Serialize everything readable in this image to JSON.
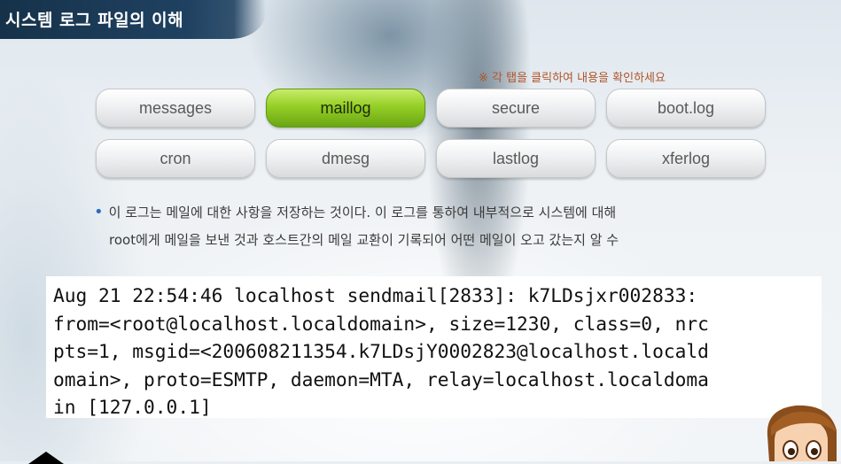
{
  "title": "시스템 로그 파일의 이해",
  "notice": "※ 각 탭을 클릭하여 내용을 확인하세요",
  "tabs": [
    {
      "label": "messages",
      "active": false
    },
    {
      "label": "maillog",
      "active": true
    },
    {
      "label": "secure",
      "active": false
    },
    {
      "label": "boot.log",
      "active": false
    },
    {
      "label": "cron",
      "active": false
    },
    {
      "label": "dmesg",
      "active": false
    },
    {
      "label": "lastlog",
      "active": false
    },
    {
      "label": "xferlog",
      "active": false
    }
  ],
  "description": {
    "line1": "이 로그는 메일에 대한 사항을 저장하는 것이다. 이 로그를 통하여 내부적으로 시스템에 대해",
    "line2": "root에게 메일을 보낸 것과 호스트간의 메일 교환이 기록되어 어떤 메일이 오고 갔는지 알 수"
  },
  "log_lines": [
    "Aug 21 22:54:46 localhost sendmail[2833]: k7LDsjxr002833:",
    "from=<root@localhost.localdomain>, size=1230, class=0, nrc",
    "pts=1, msgid=<200608211354.k7LDsjY0002823@localhost.locald",
    "omain>, proto=ESMTP, daemon=MTA, relay=localhost.localdoma",
    "in [127.0.0.1]"
  ],
  "colors": {
    "title_bg": "#1f4161",
    "active_tab": "#95cf26",
    "notice": "#b0552a",
    "bullet": "#2a6cc0"
  }
}
